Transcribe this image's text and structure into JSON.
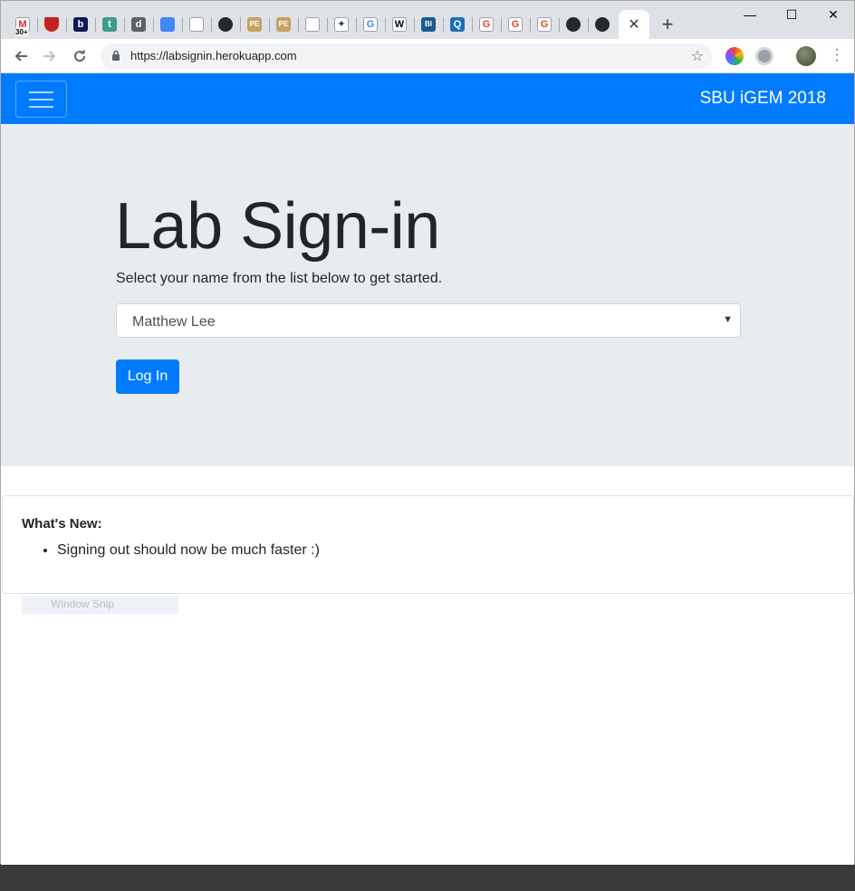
{
  "browser": {
    "tabs": [
      {
        "icon": "gmail-icon",
        "label": "M",
        "color": "#ffffff",
        "text_color": "#d93025",
        "badge": "30+"
      },
      {
        "icon": "shield-icon",
        "label": "",
        "color": "#c5221f"
      },
      {
        "icon": "b-icon",
        "label": "b",
        "color": "#0b1a5c"
      },
      {
        "icon": "t-icon",
        "label": "t",
        "color": "#3d9c8c"
      },
      {
        "icon": "doc-edit-icon",
        "label": "d",
        "color": "#5f6368"
      },
      {
        "icon": "google-docs-icon",
        "label": "",
        "color": "#4285f4"
      },
      {
        "icon": "blank-page-icon",
        "label": "",
        "color": "#ffffff"
      },
      {
        "icon": "github-icon",
        "label": "",
        "color": "#24292e"
      },
      {
        "icon": "pe-icon",
        "label": "PE",
        "color": "#c8a064"
      },
      {
        "icon": "pe-icon-2",
        "label": "PE",
        "color": "#c8a064"
      },
      {
        "icon": "blank-page-icon-2",
        "label": "",
        "color": "#ffffff"
      },
      {
        "icon": "star-sparkle-icon",
        "label": "✦",
        "color": "#ffffff",
        "text_color": "#1a3d7c"
      },
      {
        "icon": "google-icon",
        "label": "G",
        "color": "#ffffff",
        "text_color": "#4285f4"
      },
      {
        "icon": "wikipedia-icon",
        "label": "W",
        "color": "#ffffff",
        "text_color": "#000000"
      },
      {
        "icon": "bi-icon",
        "label": "BI",
        "color": "#1c5a8a"
      },
      {
        "icon": "q-icon",
        "label": "Q",
        "color": "#1d6fb8"
      },
      {
        "icon": "google-icon-2",
        "label": "G",
        "color": "#ffffff",
        "text_color": "#ea4335"
      },
      {
        "icon": "google-icon-3",
        "label": "G",
        "color": "#ffffff",
        "text_color": "#ea4335"
      },
      {
        "icon": "google-icon-4",
        "label": "G",
        "color": "#ffffff",
        "text_color": "#ea4335"
      },
      {
        "icon": "github-icon-2",
        "label": "",
        "color": "#24292e"
      },
      {
        "icon": "github-icon-3",
        "label": "",
        "color": "#24292e"
      }
    ],
    "active_tab_close": "✕",
    "new_tab": "+",
    "window_controls": {
      "minimize": "—",
      "maximize": "☐",
      "close": "✕"
    },
    "url": "https://labsignin.herokuapp.com"
  },
  "page": {
    "brand": "SBU iGEM 2018",
    "title": "Lab Sign-in",
    "lead": "Select your name from the list below to get started.",
    "select_value": "Matthew Lee",
    "login_button": "Log In",
    "whats_new_heading": "What's New:",
    "whats_new_items": [
      "Signing out should now be much faster :)"
    ]
  },
  "overlay": {
    "snip_label": "Window Snip"
  },
  "colors": {
    "primary": "#007bff",
    "jumbotron": "#e9ecef",
    "chrome_frame": "#dee1e6"
  }
}
